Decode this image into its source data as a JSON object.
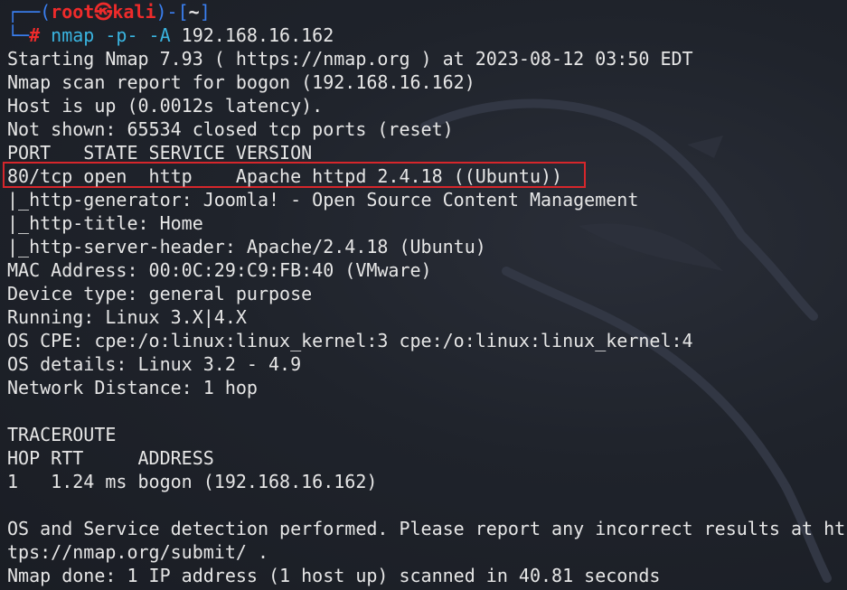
{
  "prompt": {
    "open_corner": "┌──(",
    "user": "root",
    "at_symbol": "㉿",
    "host": "kali",
    "close_paren": ")-[",
    "path": "~",
    "close_bracket": "]",
    "second_corner": "└─",
    "hash": "#",
    "command": " nmap -p- -A",
    "target": " 192.168.16.162"
  },
  "output": {
    "l01": "Starting Nmap 7.93 ( https://nmap.org ) at 2023-08-12 03:50 EDT",
    "l02": "Nmap scan report for bogon (192.168.16.162)",
    "l03": "Host is up (0.0012s latency).",
    "l04": "Not shown: 65534 closed tcp ports (reset)",
    "l05": "PORT   STATE SERVICE VERSION",
    "l06": "80/tcp open  http    Apache httpd 2.4.18 ((Ubuntu))",
    "l07": "|_http-generator: Joomla! - Open Source Content Management",
    "l08": "|_http-title: Home",
    "l09": "|_http-server-header: Apache/2.4.18 (Ubuntu)",
    "l10": "MAC Address: 00:0C:29:C9:FB:40 (VMware)",
    "l11": "Device type: general purpose",
    "l12": "Running: Linux 3.X|4.X",
    "l13": "OS CPE: cpe:/o:linux:linux_kernel:3 cpe:/o:linux:linux_kernel:4",
    "l14": "OS details: Linux 3.2 - 4.9",
    "l15": "Network Distance: 1 hop",
    "l16": "",
    "l17": "TRACEROUTE",
    "l18": "HOP RTT     ADDRESS",
    "l19": "1   1.24 ms bogon (192.168.16.162)",
    "l20": "",
    "l21": "OS and Service detection performed. Please report any incorrect results at ht",
    "l22": "tps://nmap.org/submit/ .",
    "l23": "Nmap done: 1 IP address (1 host up) scanned in 40.81 seconds"
  },
  "colors": {
    "background": "#1d2028",
    "text": "#e6e6e6",
    "prompt_frame": "#3a7ff0",
    "prompt_user": "#ee2b2b",
    "command": "#3ab4e0",
    "highlight_box": "#d6262b"
  }
}
